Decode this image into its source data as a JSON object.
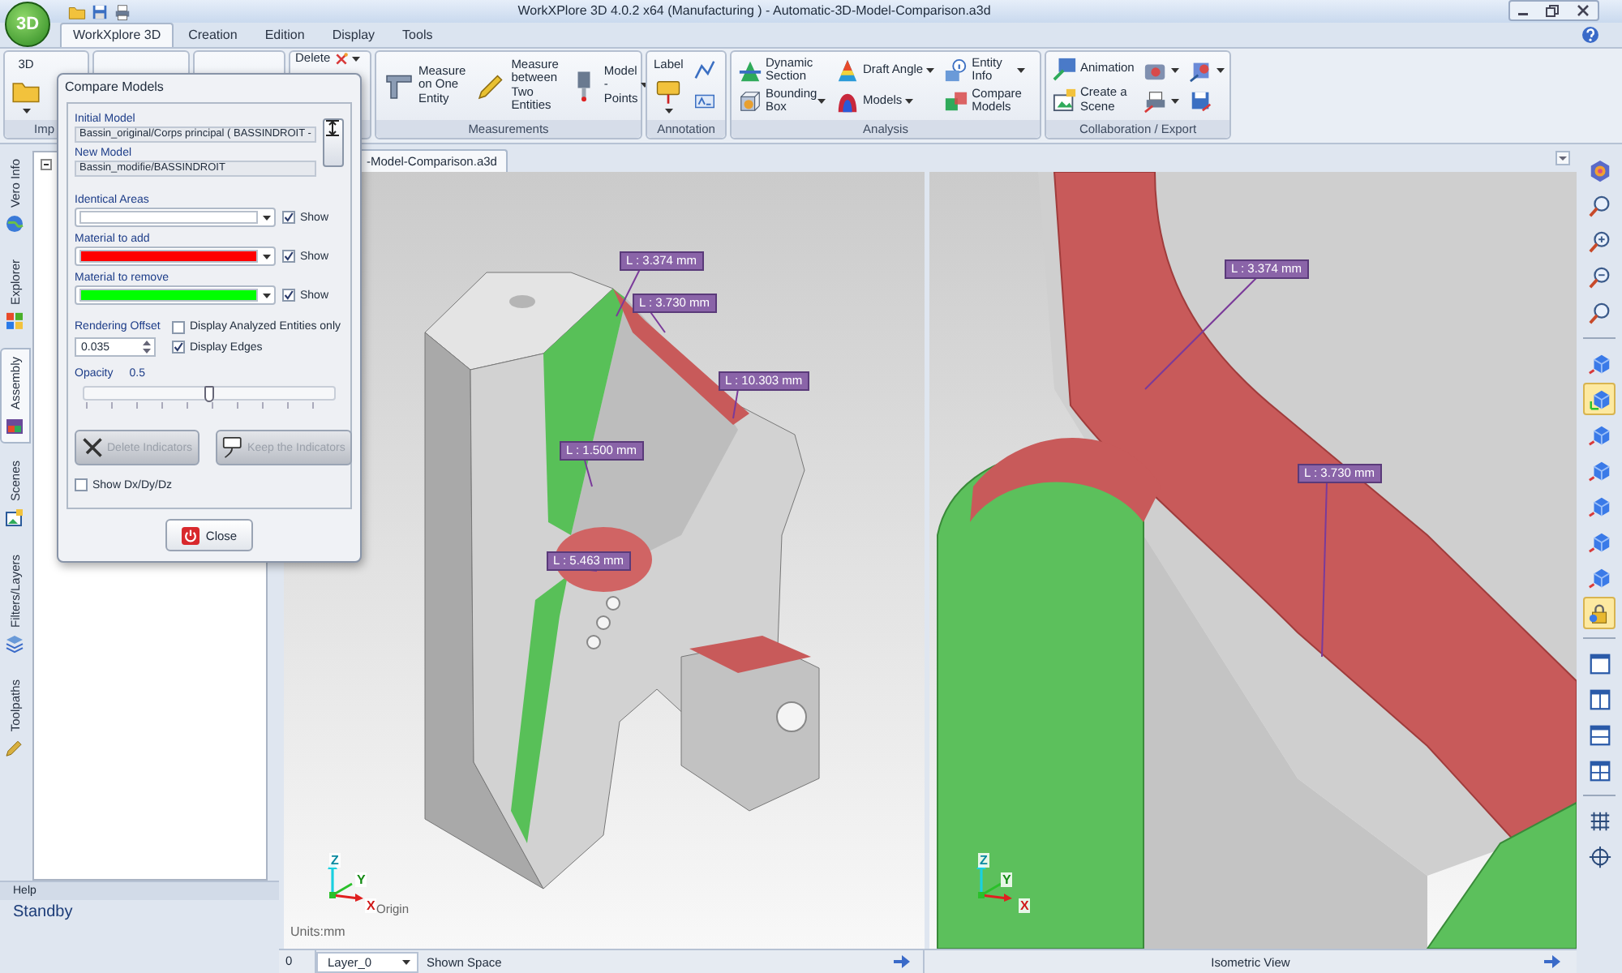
{
  "window": {
    "title": "WorkXPlore 3D 4.0.2 x64 (Manufacturing ) - Automatic-3D-Model-Comparison.a3d"
  },
  "app_logo": "3D",
  "menu_tabs": [
    {
      "label": "WorkXplore 3D",
      "selected": true
    },
    {
      "label": "Creation",
      "selected": false
    },
    {
      "label": "Edition",
      "selected": false
    },
    {
      "label": "Display",
      "selected": false
    },
    {
      "label": "Tools",
      "selected": false
    }
  ],
  "ribbon": [
    {
      "label": "Imp",
      "columns": [
        [
          {
            "label": "3D",
            "kind": "stacked",
            "dropdown": true
          }
        ]
      ]
    },
    {
      "columns": [
        [
          {
            "label": "Delete",
            "kind": "top",
            "dropdown": true
          }
        ]
      ]
    },
    {
      "label": "Measurements",
      "columns": [
        [
          {
            "label": "Measure on One Entity",
            "kind": "wide"
          }
        ],
        [
          {
            "label": "Measure between Two Entities",
            "kind": "wide"
          }
        ],
        [
          {
            "label": "Model - Points",
            "kind": "wide",
            "dropdown": true
          }
        ]
      ]
    },
    {
      "label": "Annotation",
      "columns": [
        [
          {
            "label": "Label",
            "kind": "stacked",
            "dropdown": true
          }
        ],
        [
          {
            "kind": "icon"
          },
          {
            "kind": "icon"
          }
        ]
      ]
    },
    {
      "label": "Analysis",
      "columns": [
        [
          {
            "label": "Dynamic Section",
            "kind": "small"
          },
          {
            "label": "Bounding Box",
            "kind": "small",
            "dropdown": true
          }
        ],
        [
          {
            "label": "Draft Angle",
            "kind": "small",
            "dropdown": true
          },
          {
            "label": "Models",
            "kind": "small",
            "dropdown": true
          }
        ],
        [
          {
            "label": "Entity Info",
            "kind": "small",
            "dropdown": true
          },
          {
            "label": "Compare Models",
            "kind": "small"
          }
        ]
      ]
    },
    {
      "label": "Collaboration / Export",
      "columns": [
        [
          {
            "label": "Animation",
            "kind": "small"
          },
          {
            "label": "Create a Scene",
            "kind": "small"
          }
        ],
        [
          {
            "kind": "icon",
            "dropdown": true
          },
          {
            "kind": "icon",
            "dropdown": true
          }
        ],
        [
          {
            "kind": "icon",
            "dropdown": true
          },
          {
            "kind": "icon"
          }
        ]
      ]
    }
  ],
  "side_tabs": [
    {
      "label": "Vero Info",
      "selected": false
    },
    {
      "label": "Explorer",
      "selected": false
    },
    {
      "label": "Assembly",
      "selected": true
    },
    {
      "label": "Scenes",
      "selected": false
    },
    {
      "label": "Filters/Layers",
      "selected": false
    },
    {
      "label": "Toolpaths",
      "selected": false
    }
  ],
  "help": {
    "title": "Help",
    "status": "Standby"
  },
  "document_tab": "-Model-Comparison.a3d",
  "viewports": [
    {
      "labels": [
        "L : 3.374 mm",
        "L : 3.730 mm",
        "L : 10.303 mm",
        "L : 1.500 mm",
        "L : 5.463 mm"
      ],
      "axes": [
        "Z",
        "Y",
        "X"
      ],
      "origin": "Origin",
      "units": "Units:mm"
    },
    {
      "labels": [
        "L : 3.374 mm",
        "L : 3.730 mm"
      ],
      "axes": [
        "Z",
        "Y",
        "X"
      ]
    }
  ],
  "status_bar": {
    "layer_index": "0",
    "layer": "Layer_0",
    "left_view": "Shown Space",
    "right_view": "Isometric View"
  },
  "view_toolbar": [
    [
      {
        "kind": "orb",
        "selected": false
      },
      {
        "kind": "zoom",
        "selected": false
      },
      {
        "kind": "zoom",
        "selected": false
      },
      {
        "kind": "zoom",
        "selected": false
      },
      {
        "kind": "zoom",
        "selected": false
      }
    ],
    [
      {
        "kind": "view",
        "selected": false
      },
      {
        "kind": "view",
        "selected": true
      },
      {
        "kind": "view",
        "selected": false
      },
      {
        "kind": "view",
        "selected": false
      },
      {
        "kind": "view",
        "selected": false
      },
      {
        "kind": "view",
        "selected": false
      },
      {
        "kind": "view",
        "selected": false
      },
      {
        "kind": "lock",
        "selected": true
      }
    ],
    [
      {
        "kind": "layout",
        "selected": false
      },
      {
        "kind": "layout",
        "selected": false
      },
      {
        "kind": "layout",
        "selected": false
      },
      {
        "kind": "layout",
        "selected": false
      }
    ],
    [
      {
        "kind": "grid",
        "selected": false
      },
      {
        "kind": "target",
        "selected": false
      }
    ]
  ],
  "dialog": {
    "title": "Compare Models",
    "initial_model": {
      "label": "Initial Model",
      "value": "Bassin_original/Corps principal ( BASSINDROIT -"
    },
    "new_model": {
      "label": "New Model",
      "value": "Bassin_modifie/BASSINDROIT"
    },
    "color_settings": [
      {
        "label": "Identical Areas",
        "color": "#ffffff",
        "show_label": "Show",
        "show_checked": true
      },
      {
        "label": "Material to add",
        "color": "#ff0000",
        "show_label": "Show",
        "show_checked": true
      },
      {
        "label": "Material to remove",
        "color": "#00ff00",
        "show_label": "Show",
        "show_checked": true
      }
    ],
    "rendering_offset": {
      "label": "Rendering Offset",
      "value": "0.035"
    },
    "options": [
      {
        "label": "Display Analyzed Entities only",
        "checked": false
      },
      {
        "label": "Display Edges",
        "checked": true
      }
    ],
    "opacity": {
      "label": "Opacity",
      "reading": "0.5",
      "level": 0.5
    },
    "actions": [
      {
        "label": "Delete Indicators",
        "disabled": true
      },
      {
        "label": "Keep the Indicators",
        "disabled": true
      }
    ],
    "show_deltas": {
      "label": "Show Dx/Dy/Dz",
      "checked": false
    },
    "close_label": "Close"
  }
}
